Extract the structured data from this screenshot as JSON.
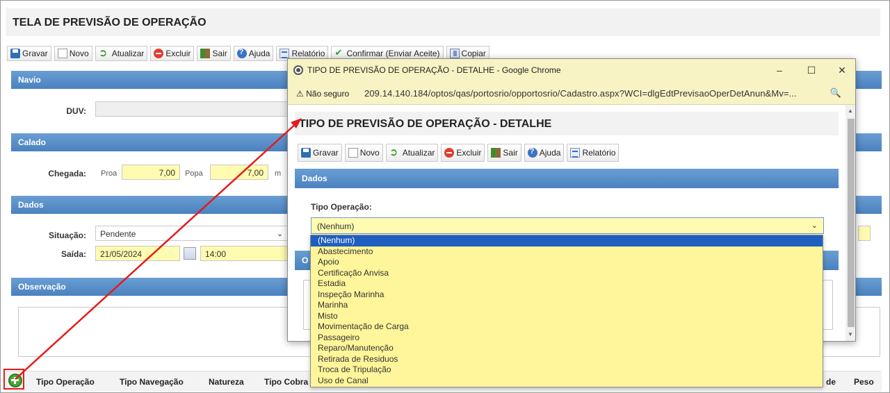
{
  "page": {
    "title": "TELA DE PREVISÃO DE OPERAÇÃO"
  },
  "toolbar": {
    "gravar": "Gravar",
    "novo": "Novo",
    "atualizar": "Atualizar",
    "excluir": "Excluir",
    "sair": "Sair",
    "ajuda": "Ajuda",
    "relatorio": "Relatório",
    "confirmar": "Confirmar (Enviar Aceite)",
    "copiar": "Copiar"
  },
  "sections": {
    "navio": "Navio",
    "calado": "Calado",
    "dados": "Dados",
    "observacao": "Observação"
  },
  "navio": {
    "duv_label": "DUV:",
    "duv_value": ""
  },
  "calado": {
    "chegada_label": "Chegada:",
    "proa_label": "Proa",
    "proa_value": "7,00",
    "popa_label": "Popa",
    "popa_value": "7,00",
    "unit": "m"
  },
  "dados": {
    "situacao_label": "Situação:",
    "situacao_value": "Pendente",
    "saida_label": "Saída:",
    "saida_date": "21/05/2024",
    "saida_time": "14:00"
  },
  "grid": {
    "columns": [
      "Tipo Operação",
      "Tipo Navegação",
      "Natureza",
      "Tipo Cobra",
      "de",
      "Peso"
    ]
  },
  "popup": {
    "window_title": "TIPO DE PREVISÃO DE OPERAÇÃO - DETALHE - Google Chrome",
    "minimize": "–",
    "maximize": "☐",
    "close": "✕",
    "security_warning": "Não seguro",
    "url": "209.14.140.184/optos/qas/portosrio/opportosrio/Cadastro.aspx?WCI=dlgEdtPrevisaoOperDetAnun&Mv=...",
    "page_title": "TIPO DE PREVISÃO DE OPERAÇÃO - DETALHE",
    "toolbar": {
      "gravar": "Gravar",
      "novo": "Novo",
      "atualizar": "Atualizar",
      "excluir": "Excluir",
      "sair": "Sair",
      "ajuda": "Ajuda",
      "relatorio": "Relatório"
    },
    "section_dados": "Dados",
    "section_o": "O",
    "tipo_operacao_label": "Tipo Operação:",
    "tipo_operacao_selected": "(Nenhum)",
    "options": [
      "(Nenhum)",
      "Abastecimento",
      "Apoio",
      "Certificação Anvisa",
      "Estadia",
      "Inspeção Marinha",
      "Marinha",
      "Misto",
      "Movimentação de Carga",
      "Passageiro",
      "Reparo/Manutenção",
      "Retirada de Residuos",
      "Troca de Tripulação",
      "Uso de Canal"
    ]
  },
  "colors": {
    "section_blue": "#5a8fc8",
    "field_yellow": "#fffbb0",
    "dropdown_selected": "#1f5fbf",
    "annotation_red": "#e31b1b",
    "chrome_bar": "#f7f3c4"
  }
}
